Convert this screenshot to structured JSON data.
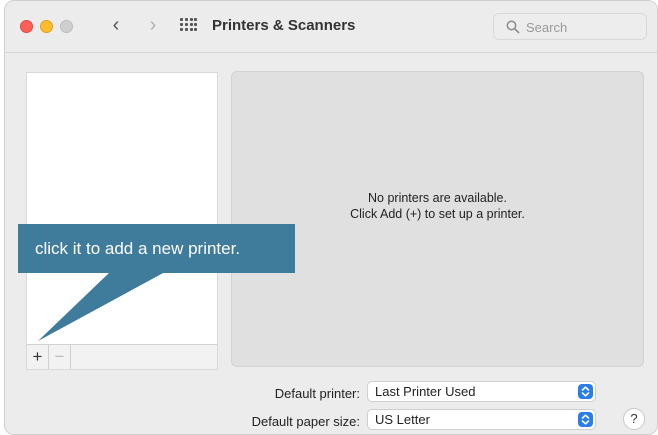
{
  "window": {
    "title": "Printers & Scanners",
    "nav_back": "‹",
    "nav_forward": "›"
  },
  "search": {
    "placeholder": "Search"
  },
  "printer_list": {
    "add_label": "+",
    "remove_label": "−"
  },
  "detail": {
    "line1": "No printers are available.",
    "line2": "Click Add (+) to set up a printer."
  },
  "callout": {
    "text": "click it to add a new printer."
  },
  "settings": {
    "default_printer_label": "Default printer:",
    "default_printer_value": "Last Printer Used",
    "default_paper_label": "Default paper size:",
    "default_paper_value": "US Letter"
  },
  "help": {
    "label": "?"
  },
  "colors": {
    "callout": "#3f7b9a",
    "accent": "#2b7de9",
    "close": "#fe5f57",
    "minimize": "#febc2e"
  }
}
